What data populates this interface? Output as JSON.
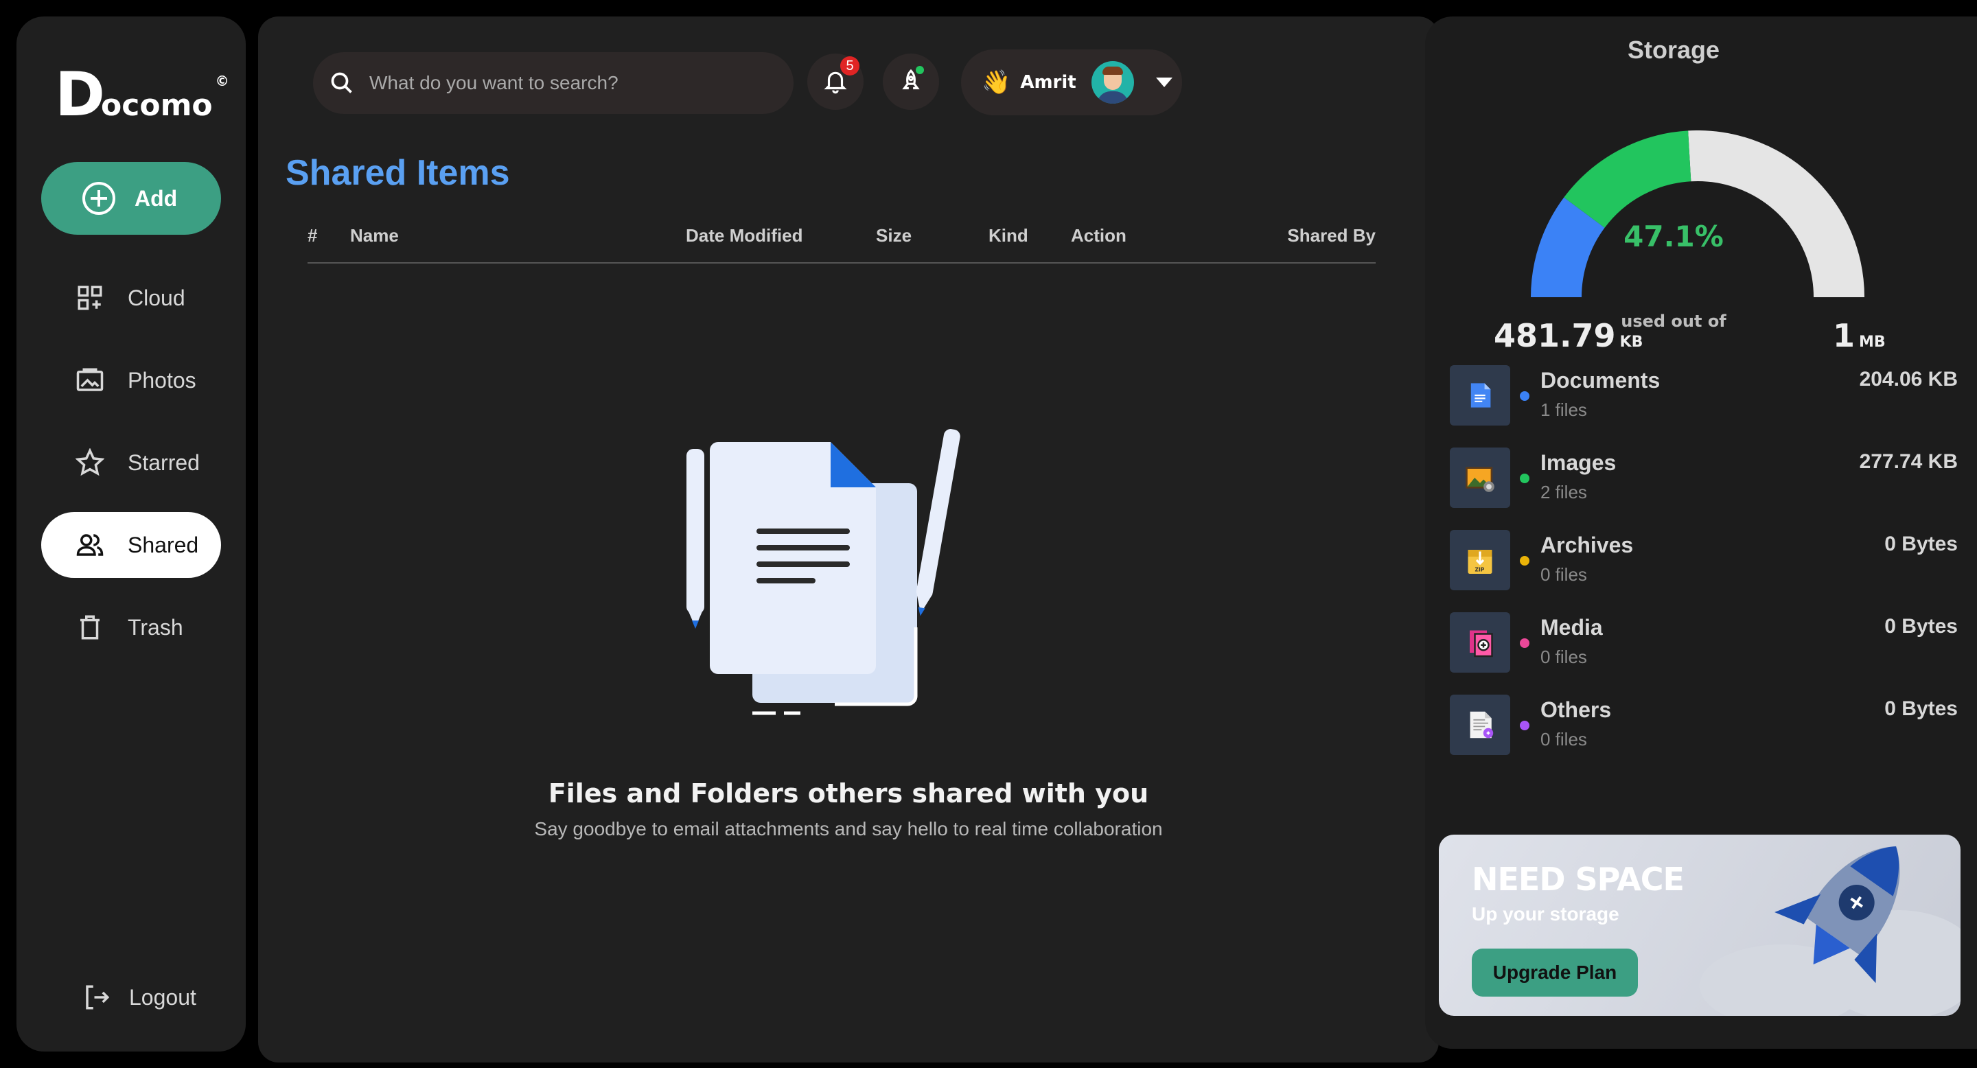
{
  "logo": {
    "first": "D",
    "rest": "ocomo",
    "mark": "©"
  },
  "sidebar": {
    "add_label": "Add",
    "items": [
      {
        "label": "Cloud",
        "icon": "grid-plus-icon"
      },
      {
        "label": "Photos",
        "icon": "photo-icon"
      },
      {
        "label": "Starred",
        "icon": "star-icon"
      },
      {
        "label": "Shared",
        "icon": "users-icon",
        "active": true
      },
      {
        "label": "Trash",
        "icon": "trash-icon"
      }
    ],
    "logout_label": "Logout"
  },
  "header": {
    "search_placeholder": "What do you want to search?",
    "notification_count": "5",
    "user": {
      "wave": "👋",
      "name": "Amrit"
    }
  },
  "main": {
    "title": "Shared Items",
    "columns": [
      "#",
      "Name",
      "Date Modified",
      "Size",
      "Kind",
      "Action",
      "Shared By"
    ],
    "empty_title": "Files and Folders others shared with you",
    "empty_subtitle": "Say goodbye to email attachments and say hello to real time collaboration"
  },
  "storage": {
    "title": "Storage",
    "percent": "47.1%",
    "percent_value": 47.1,
    "used": "481.79",
    "used_unit": "KB",
    "used_out_of": "used out of",
    "total": "1",
    "total_unit": "MB",
    "gauge_colors": {
      "documents": "#3b82f6",
      "images": "#22c55e",
      "free": "#e5e5e5"
    },
    "categories": [
      {
        "name": "Documents",
        "count": "1 files",
        "size": "204.06 KB",
        "color": "#3b82f6",
        "icon": "document-icon"
      },
      {
        "name": "Images",
        "count": "2 files",
        "size": "277.74 KB",
        "color": "#22c55e",
        "icon": "image-icon"
      },
      {
        "name": "Archives",
        "count": "0 files",
        "size": "0 Bytes",
        "color": "#eab308",
        "icon": "archive-icon"
      },
      {
        "name": "Media",
        "count": "0 files",
        "size": "0 Bytes",
        "color": "#ec4899",
        "icon": "media-icon"
      },
      {
        "name": "Others",
        "count": "0 files",
        "size": "0 Bytes",
        "color": "#a855f7",
        "icon": "other-file-icon"
      }
    ]
  },
  "promo": {
    "title": "NEED SPACE",
    "subtitle": "Up your storage",
    "button": "Upgrade Plan"
  }
}
